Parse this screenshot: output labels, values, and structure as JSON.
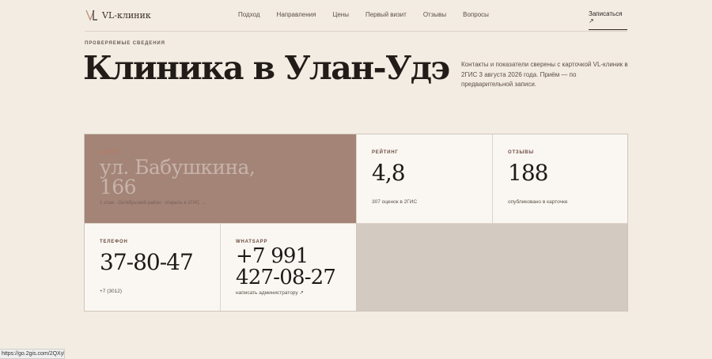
{
  "header": {
    "logo_text": "VL-клиник",
    "nav": [
      "Подход",
      "Направления",
      "Цены",
      "Первый визит",
      "Отзывы",
      "Вопросы"
    ],
    "cta": "Записаться ↗"
  },
  "hero": {
    "eyebrow": "Проверяемые сведения",
    "title": "Клиника в Улан-Удэ",
    "intro": "Контакты и показатели сверены с карточкой VL-клиник в 2ГИС 3 августа 2026 года. Приём — по предварительной записи."
  },
  "facts": {
    "address": {
      "label": "Адрес",
      "value": "ул. Бабушкина, 166",
      "note": "1 этаж · Октябрьский район · открыть в 2ГИС →"
    },
    "rating": {
      "label": "Рейтинг",
      "value": "4,8",
      "note": "307 оценок в 2ГИС"
    },
    "reviews": {
      "label": "Отзывы",
      "value": "188",
      "note": "опубликовано в карточке"
    },
    "phone": {
      "label": "Телефон",
      "value": "37-80-47",
      "note": "+7 (3012)"
    },
    "whatsapp": {
      "label": "WhatsApp",
      "value": "+7 991 427-08-27",
      "note": "написать администратору ↗"
    }
  },
  "status_bar": {
    "url": "https://go.2gis.com/2QXyh"
  },
  "colors": {
    "background": "#f3ece3",
    "accent_tile": "#a38477",
    "map_tile": "#d3cbc2"
  }
}
